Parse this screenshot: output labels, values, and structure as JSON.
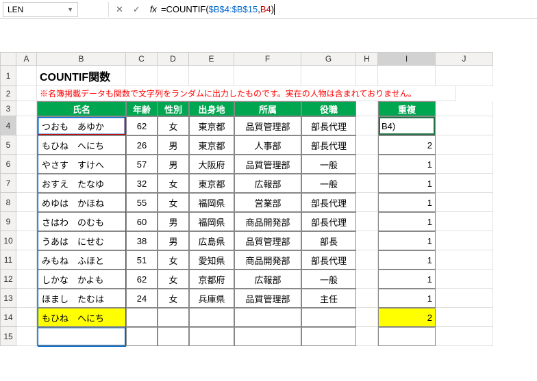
{
  "nameBox": "LEN",
  "formula": {
    "eq": "=",
    "fn": "COUNTIF",
    "op": "(",
    "range": "$B$4:$B$15",
    "sep": ",",
    "crit": "B4",
    "cl": ")"
  },
  "title": "COUNTIF関数",
  "note": "※名簿掲載データも関数で文字列をランダムに出力したものです。実在の人物は含まれておりません。",
  "cols": [
    "A",
    "B",
    "C",
    "D",
    "E",
    "F",
    "G",
    "H",
    "I",
    "J"
  ],
  "rowNums": [
    "1",
    "2",
    "3",
    "4",
    "5",
    "6",
    "7",
    "8",
    "9",
    "10",
    "11",
    "12",
    "13",
    "14",
    "15"
  ],
  "headers": {
    "name": "氏名",
    "age": "年齢",
    "sex": "性別",
    "origin": "出身地",
    "dept": "所属",
    "role": "役職",
    "dup": "重複"
  },
  "activeCellDisplay": "B4)",
  "rows": [
    {
      "name": "つおも　あゆか",
      "age": "62",
      "sex": "女",
      "origin": "東京都",
      "dept": "品質管理部",
      "role": "部長代理",
      "dup": ""
    },
    {
      "name": "もひね　へにち",
      "age": "26",
      "sex": "男",
      "origin": "東京都",
      "dept": "人事部",
      "role": "部長代理",
      "dup": "2"
    },
    {
      "name": "やさす　すけへ",
      "age": "57",
      "sex": "男",
      "origin": "大阪府",
      "dept": "品質管理部",
      "role": "一般",
      "dup": "1"
    },
    {
      "name": "おすえ　たなゆ",
      "age": "32",
      "sex": "女",
      "origin": "東京都",
      "dept": "広報部",
      "role": "一般",
      "dup": "1"
    },
    {
      "name": "めゆは　かほね",
      "age": "55",
      "sex": "女",
      "origin": "福岡県",
      "dept": "営業部",
      "role": "部長代理",
      "dup": "1"
    },
    {
      "name": "さはわ　のむも",
      "age": "60",
      "sex": "男",
      "origin": "福岡県",
      "dept": "商品開発部",
      "role": "部長代理",
      "dup": "1"
    },
    {
      "name": "うあは　にせむ",
      "age": "38",
      "sex": "男",
      "origin": "広島県",
      "dept": "品質管理部",
      "role": "部長",
      "dup": "1"
    },
    {
      "name": "みもね　ふほと",
      "age": "51",
      "sex": "女",
      "origin": "愛知県",
      "dept": "商品開発部",
      "role": "部長代理",
      "dup": "1"
    },
    {
      "name": "しかな　かよも",
      "age": "62",
      "sex": "女",
      "origin": "京都府",
      "dept": "広報部",
      "role": "一般",
      "dup": "1"
    },
    {
      "name": "ほまし　たむは",
      "age": "24",
      "sex": "女",
      "origin": "兵庫県",
      "dept": "品質管理部",
      "role": "主任",
      "dup": "1"
    },
    {
      "name": "もひね　へにち",
      "age": "",
      "sex": "",
      "origin": "",
      "dept": "",
      "role": "",
      "dup": "2"
    }
  ]
}
